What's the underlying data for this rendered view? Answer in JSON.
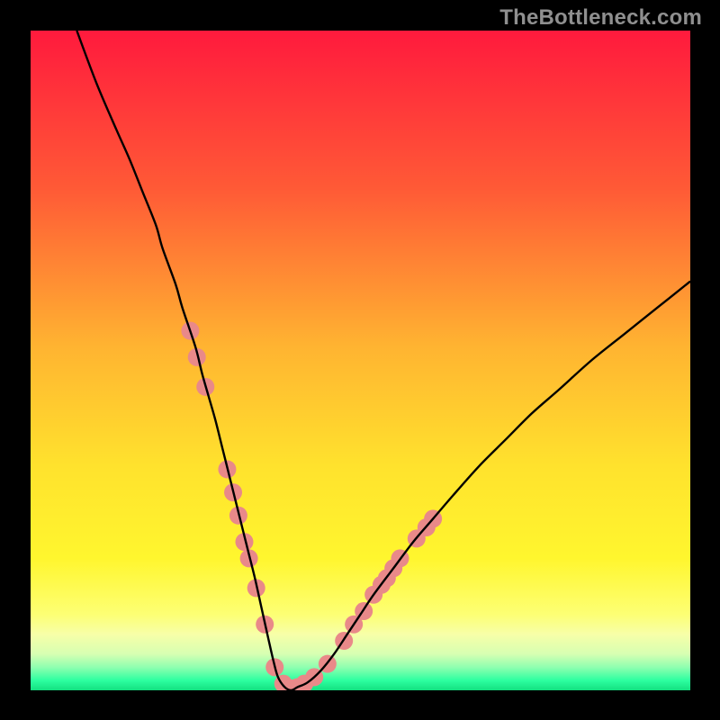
{
  "watermark": "TheBottleneck.com",
  "chart_data": {
    "type": "line",
    "title": "",
    "xlabel": "",
    "ylabel": "",
    "xlim": [
      0,
      100
    ],
    "ylim": [
      0,
      100
    ],
    "grid": false,
    "legend": false,
    "background_gradient": {
      "stops": [
        {
          "pos": 0.0,
          "color": "#ff1a3d"
        },
        {
          "pos": 0.24,
          "color": "#ff5a36"
        },
        {
          "pos": 0.48,
          "color": "#ffb431"
        },
        {
          "pos": 0.66,
          "color": "#ffe22d"
        },
        {
          "pos": 0.8,
          "color": "#fff62e"
        },
        {
          "pos": 0.885,
          "color": "#fdff74"
        },
        {
          "pos": 0.915,
          "color": "#f7ffa8"
        },
        {
          "pos": 0.945,
          "color": "#d7ffb2"
        },
        {
          "pos": 0.965,
          "color": "#8fffb0"
        },
        {
          "pos": 0.985,
          "color": "#2dffa0"
        },
        {
          "pos": 1.0,
          "color": "#13e07f"
        }
      ]
    },
    "series": [
      {
        "name": "bottleneck-curve",
        "color": "#000000",
        "x": [
          7,
          10,
          13,
          15,
          17,
          19,
          20,
          22,
          23,
          25,
          26,
          27,
          28,
          29,
          30,
          31,
          32,
          33,
          34,
          35,
          36,
          36.8,
          37.5,
          38.5,
          39.5,
          40.5,
          42,
          44,
          46,
          48,
          50,
          52,
          55,
          58,
          61,
          64,
          68,
          72,
          76,
          80,
          85,
          90,
          95,
          100
        ],
        "y": [
          100,
          92,
          85,
          80.5,
          75.5,
          70.5,
          67,
          61.5,
          58,
          52,
          48,
          44.5,
          41,
          37,
          33,
          29,
          25,
          21,
          17,
          12.5,
          8,
          4.5,
          2,
          0.5,
          0,
          0.5,
          1.2,
          3,
          5.5,
          8.5,
          11.5,
          14.5,
          18.5,
          22.5,
          26,
          29.5,
          34,
          38,
          42,
          45.5,
          50,
          54,
          58,
          62
        ]
      }
    ],
    "markers": {
      "name": "highlight-dots",
      "color": "#e98989",
      "radius_px": 10,
      "points": [
        {
          "x": 24.2,
          "y": 54.5
        },
        {
          "x": 25.2,
          "y": 50.5
        },
        {
          "x": 26.5,
          "y": 46.0
        },
        {
          "x": 29.8,
          "y": 33.5
        },
        {
          "x": 30.7,
          "y": 30.0
        },
        {
          "x": 31.5,
          "y": 26.5
        },
        {
          "x": 32.4,
          "y": 22.5
        },
        {
          "x": 33.1,
          "y": 20.0
        },
        {
          "x": 34.2,
          "y": 15.5
        },
        {
          "x": 35.5,
          "y": 10.0
        },
        {
          "x": 37.0,
          "y": 3.5
        },
        {
          "x": 38.3,
          "y": 1.0
        },
        {
          "x": 39.5,
          "y": 0.3
        },
        {
          "x": 40.5,
          "y": 0.5
        },
        {
          "x": 41.5,
          "y": 1.0
        },
        {
          "x": 43.0,
          "y": 2.0
        },
        {
          "x": 45.0,
          "y": 4.0
        },
        {
          "x": 47.5,
          "y": 7.5
        },
        {
          "x": 49.0,
          "y": 10.0
        },
        {
          "x": 50.5,
          "y": 12.0
        },
        {
          "x": 52.0,
          "y": 14.5
        },
        {
          "x": 53.2,
          "y": 16.0
        },
        {
          "x": 54.0,
          "y": 17.0
        },
        {
          "x": 55.0,
          "y": 18.5
        },
        {
          "x": 56.0,
          "y": 20.0
        },
        {
          "x": 58.5,
          "y": 23.0
        },
        {
          "x": 60.0,
          "y": 24.7
        },
        {
          "x": 61.0,
          "y": 26.0
        }
      ]
    }
  }
}
